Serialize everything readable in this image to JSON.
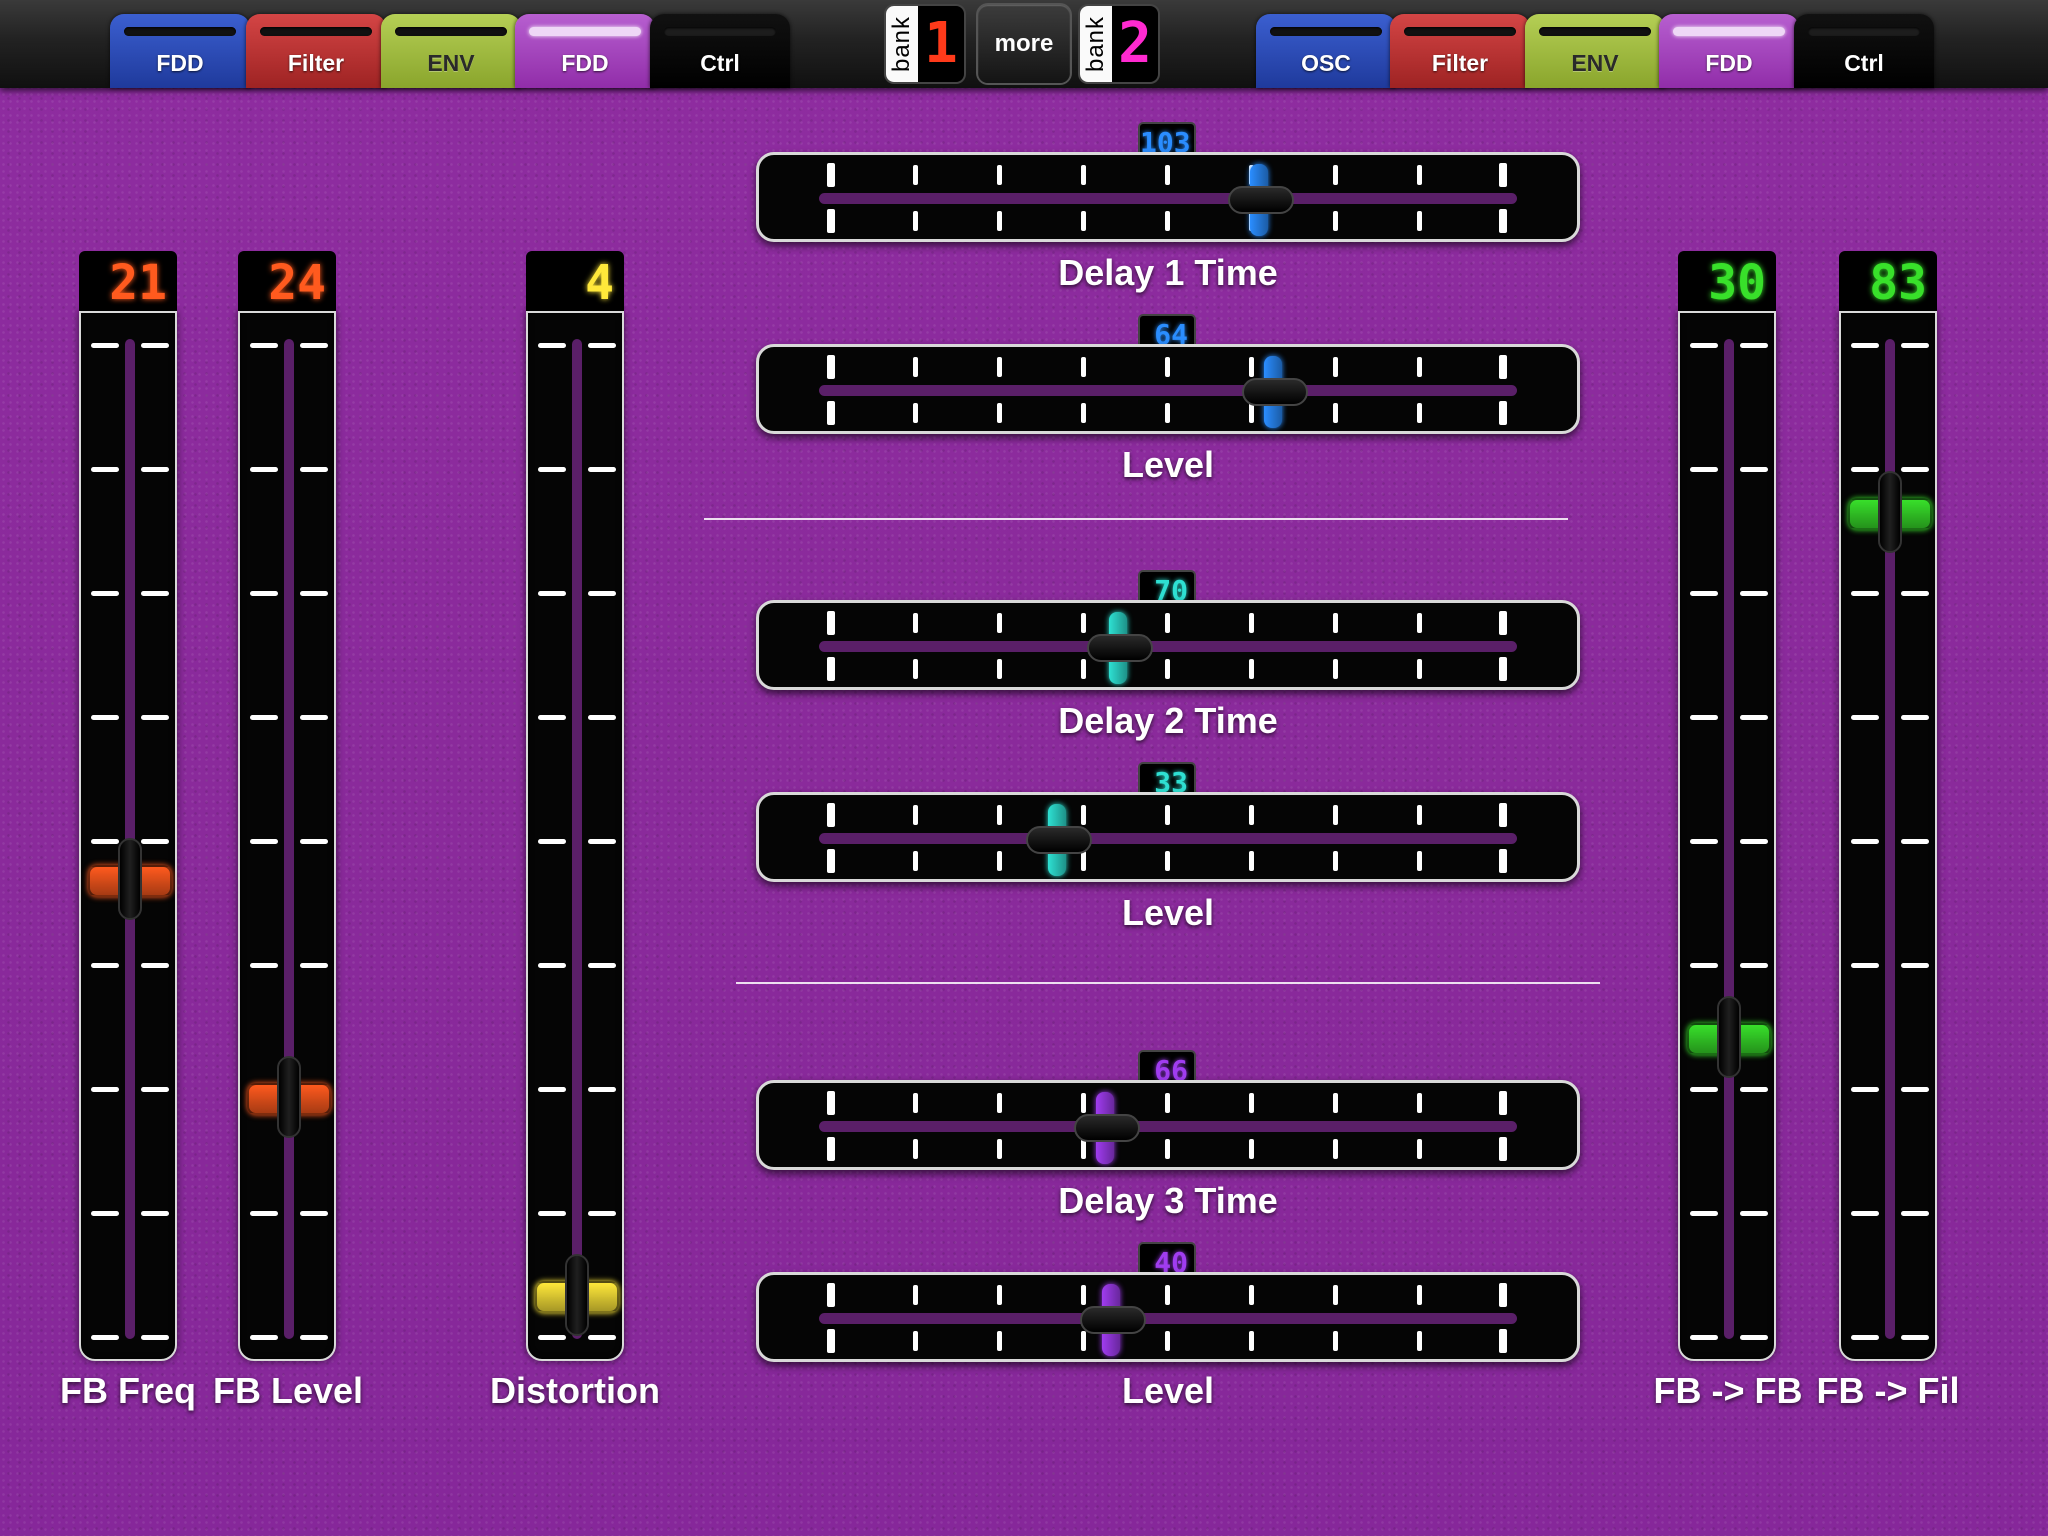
{
  "colors": {
    "orange": "#ff5a1e",
    "yellow": "#ffe83a",
    "green": "#38e02a",
    "blue": "#2a8dff",
    "teal": "#2ee0d2",
    "violet": "#a03cf0",
    "bank1": "#ff3a1a",
    "bank2": "#ff2ad0"
  },
  "tabs_left": [
    {
      "label": "FDD",
      "style": "blue"
    },
    {
      "label": "Filter",
      "style": "red"
    },
    {
      "label": "ENV",
      "style": "green"
    },
    {
      "label": "FDD",
      "style": "purple"
    },
    {
      "label": "Ctrl",
      "style": "black"
    }
  ],
  "tabs_right": [
    {
      "label": "OSC",
      "style": "blue"
    },
    {
      "label": "Filter",
      "style": "red"
    },
    {
      "label": "ENV",
      "style": "green"
    },
    {
      "label": "FDD",
      "style": "purple"
    },
    {
      "label": "Ctrl",
      "style": "black"
    }
  ],
  "bank1": {
    "word": "bank",
    "digit": "1"
  },
  "bank2": {
    "word": "bank",
    "digit": "2"
  },
  "more_label": "more",
  "vsliders": [
    {
      "label": "FB Freq",
      "value": "21",
      "fraction": 0.46,
      "color": "orange"
    },
    {
      "label": "FB Level",
      "value": "24",
      "fraction": 0.24,
      "color": "orange"
    },
    {
      "label": "Distortion",
      "value": "4",
      "fraction": 0.04,
      "color": "yellow"
    },
    {
      "label": "FB -> FB",
      "value": "30",
      "fraction": 0.3,
      "color": "green"
    },
    {
      "label": "FB -> Fil",
      "value": "83",
      "fraction": 0.83,
      "color": "green"
    }
  ],
  "hsliders": [
    {
      "label": "Delay 1 Time",
      "value": "103",
      "fraction": 0.64,
      "color": "blue"
    },
    {
      "label": "Level",
      "value": "64",
      "fraction": 0.66,
      "color": "blue"
    },
    {
      "label": "Delay 2 Time",
      "value": "70",
      "fraction": 0.43,
      "color": "teal"
    },
    {
      "label": "Level",
      "value": "33",
      "fraction": 0.34,
      "color": "teal"
    },
    {
      "label": "Delay 3 Time",
      "value": "66",
      "fraction": 0.41,
      "color": "violet"
    },
    {
      "label": "Level",
      "value": "40",
      "fraction": 0.42,
      "color": "violet"
    }
  ]
}
